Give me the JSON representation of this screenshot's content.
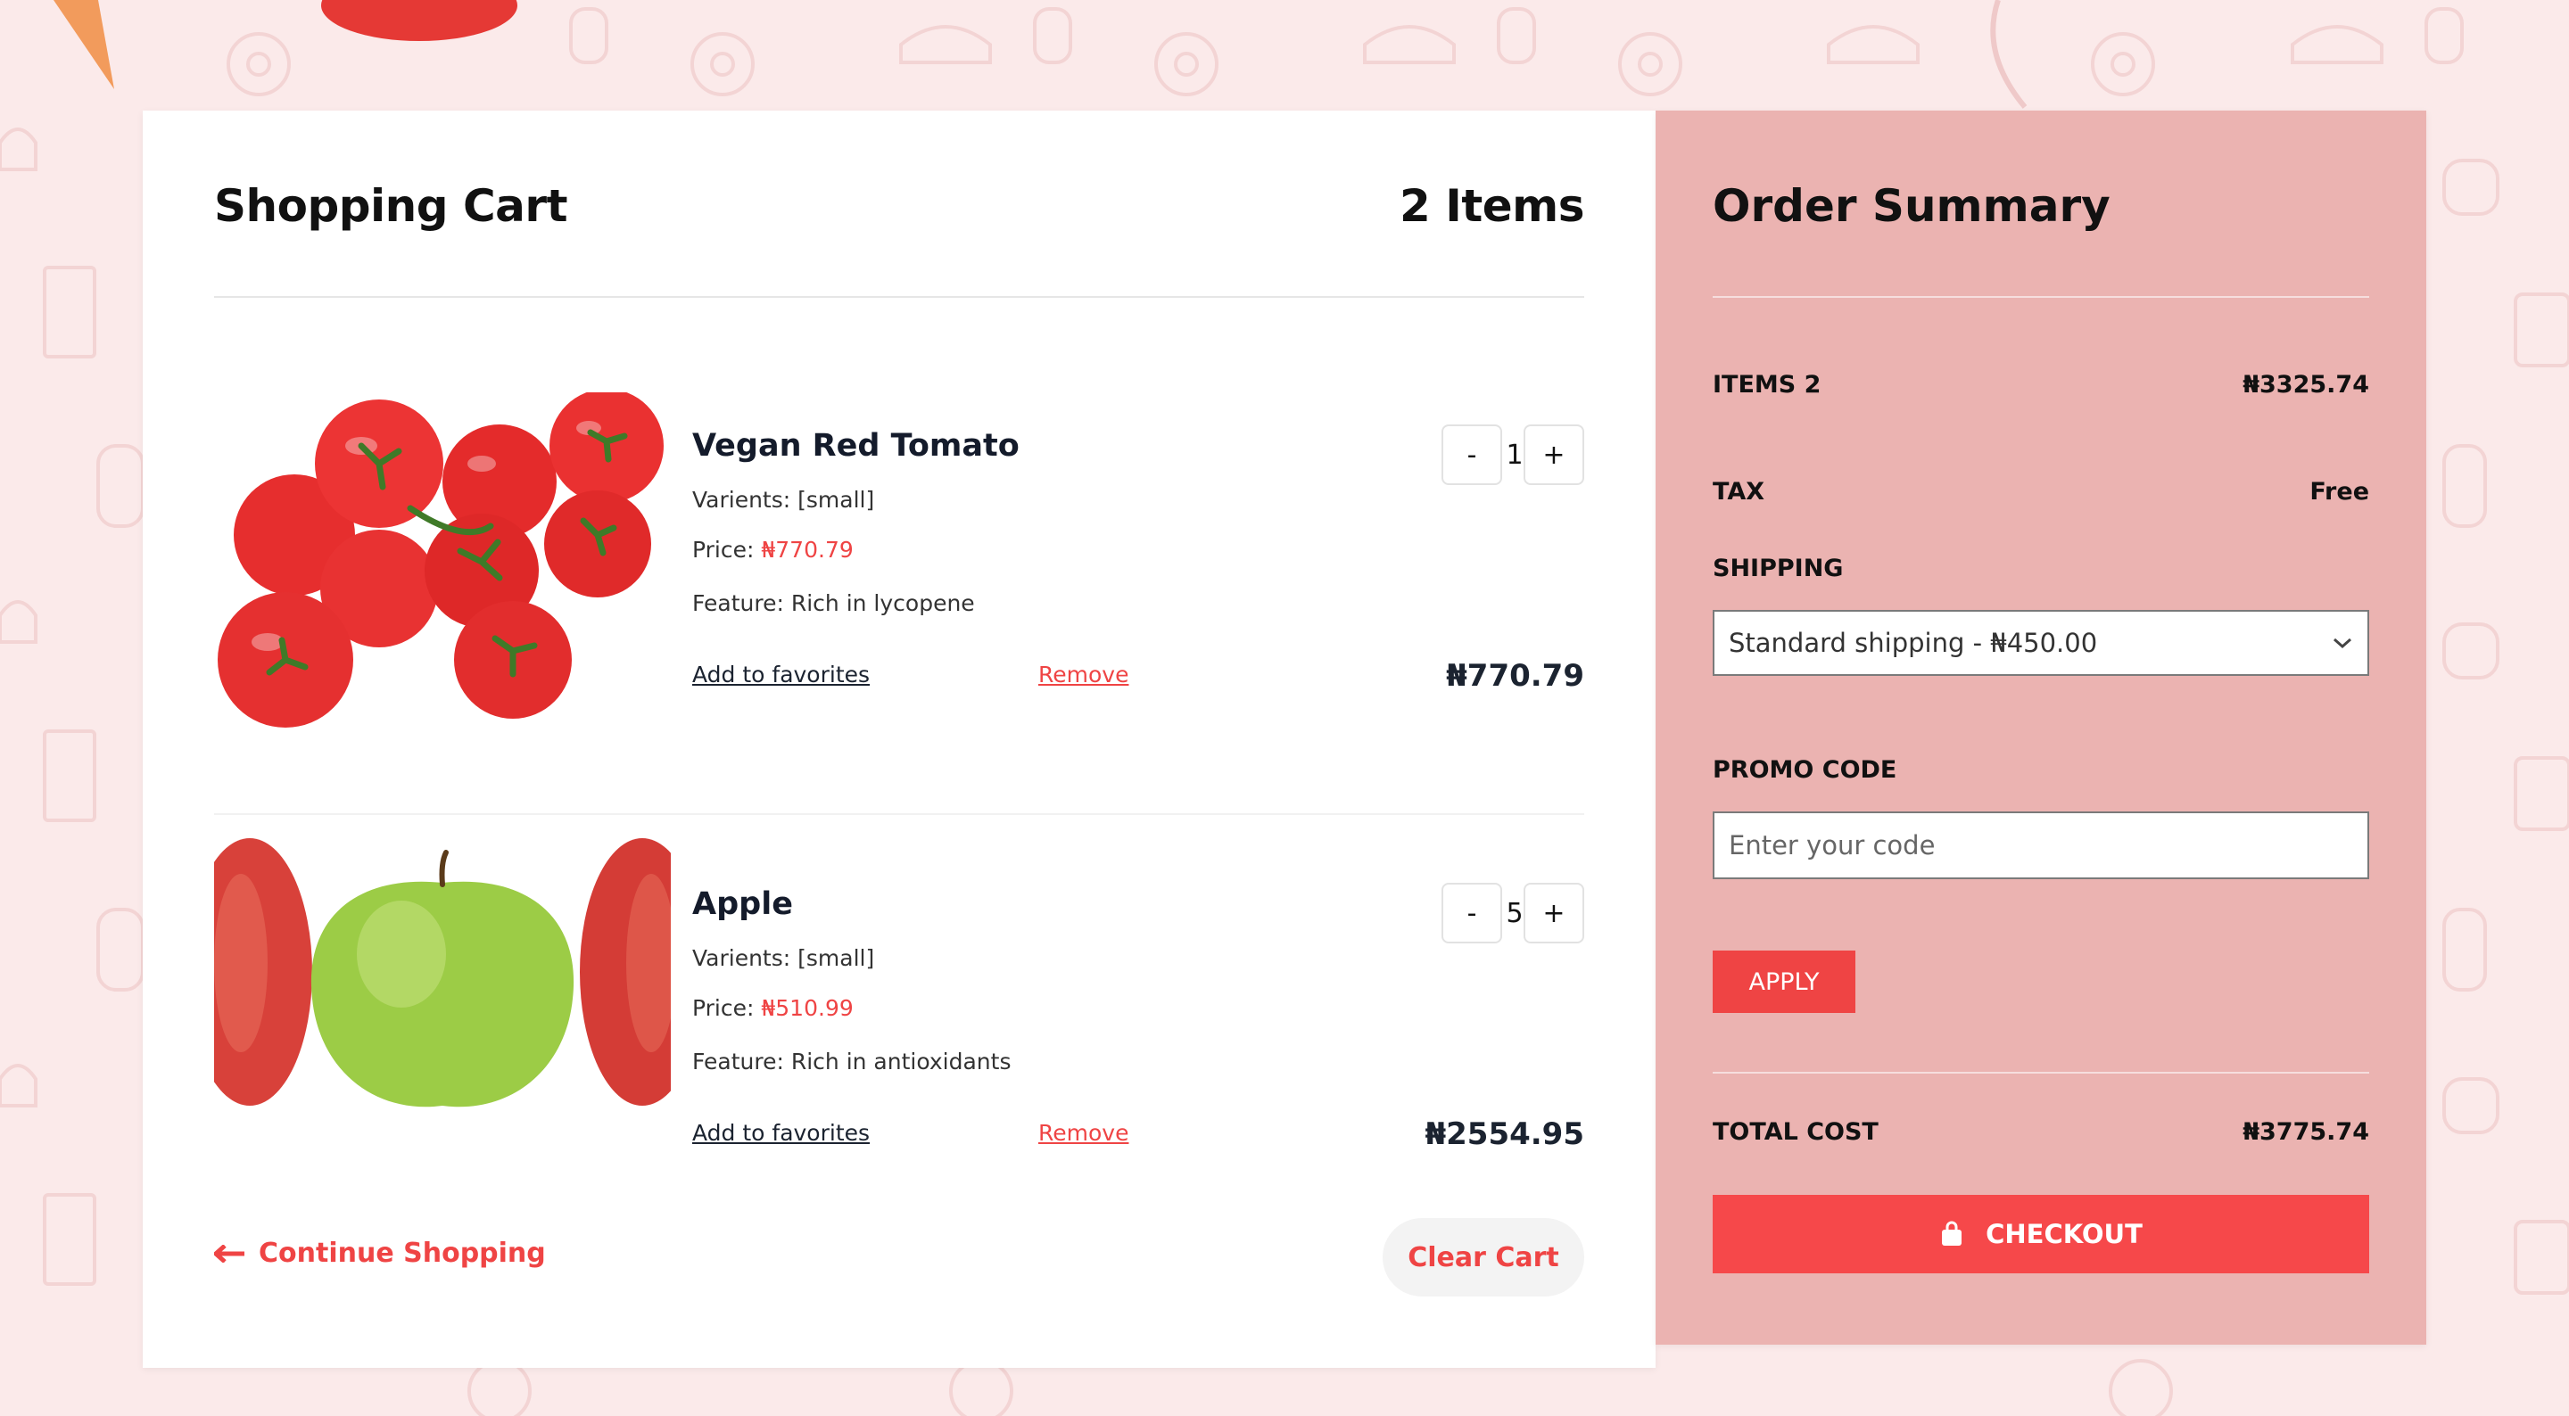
{
  "cart": {
    "title": "Shopping Cart",
    "count_label": "2 Items",
    "items": [
      {
        "name": "Vegan Red Tomato",
        "varients_label": "Varients:",
        "varients_value": "[small]",
        "price_label": "Price:",
        "price_value": "₦770.79",
        "feature": "Feature: Rich in lycopene",
        "quantity": "1",
        "add_to_favorites": "Add to favorites",
        "remove": "Remove",
        "total": "₦770.79"
      },
      {
        "name": "Apple",
        "varients_label": "Varients:",
        "varients_value": "[small]",
        "price_label": "Price:",
        "price_value": "₦510.99",
        "feature": "Feature: Rich in antioxidants",
        "quantity": "5",
        "add_to_favorites": "Add to favorites",
        "remove": "Remove",
        "total": "₦2554.95"
      }
    ],
    "minus_label": "-",
    "plus_label": "+",
    "continue_shopping": "Continue Shopping",
    "clear_cart": "Clear Cart"
  },
  "summary": {
    "title": "Order Summary",
    "items_label": "ITEMS 2",
    "items_value": "₦3325.74",
    "tax_label": "TAX",
    "tax_value": "Free",
    "shipping_label": "SHIPPING",
    "shipping_selected": "Standard shipping - ₦450.00",
    "promo_label": "PROMO CODE",
    "promo_placeholder": "Enter your code",
    "apply_label": "APPLY",
    "total_label": "TOTAL COST",
    "total_value": "₦3775.74",
    "checkout_label": "CHECKOUT"
  },
  "colors": {
    "accent": "#ef4444",
    "summary_bg": "#ebb3b1",
    "page_bg": "#fbeaea"
  },
  "icons": [
    "arrow-left-icon",
    "chevron-down-icon",
    "shopping-bag-icon"
  ]
}
